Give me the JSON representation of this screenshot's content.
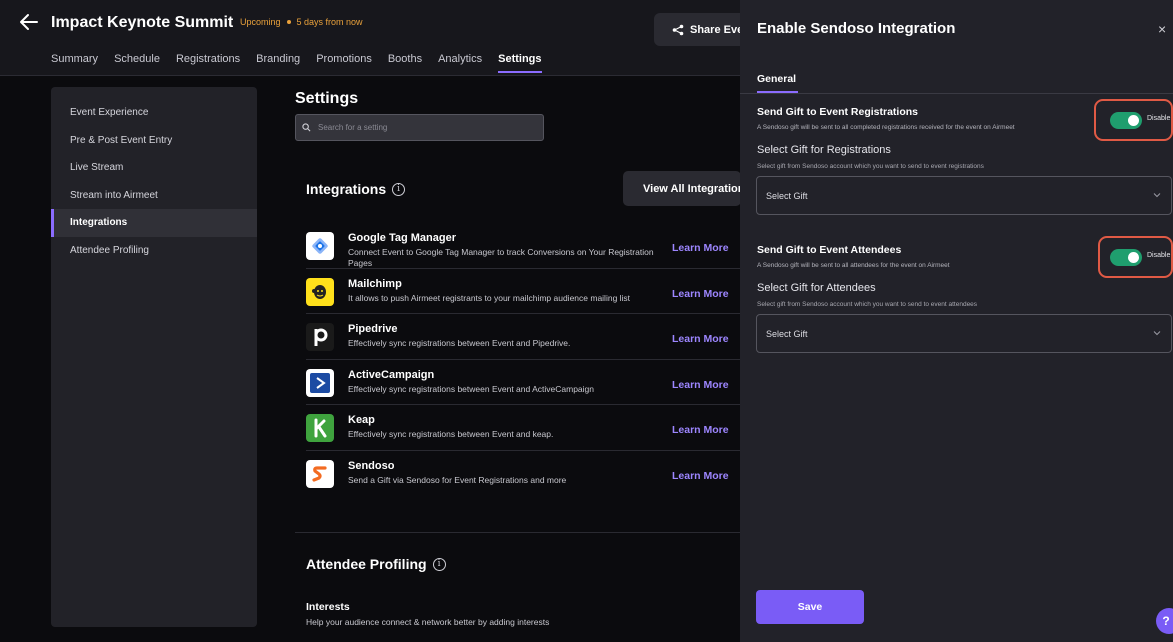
{
  "header": {
    "title": "Impact Keynote Summit",
    "status": "Upcoming",
    "countdown": "5 days from now",
    "share_label": "Share Event",
    "tabs": [
      {
        "label": "Summary"
      },
      {
        "label": "Schedule"
      },
      {
        "label": "Registrations"
      },
      {
        "label": "Branding"
      },
      {
        "label": "Promotions"
      },
      {
        "label": "Booths"
      },
      {
        "label": "Analytics"
      },
      {
        "label": "Settings",
        "active": true
      }
    ]
  },
  "sidebar": {
    "items": [
      {
        "label": "Event Experience"
      },
      {
        "label": "Pre & Post Event Entry"
      },
      {
        "label": "Live Stream"
      },
      {
        "label": "Stream into Airmeet"
      },
      {
        "label": "Integrations",
        "active": true
      },
      {
        "label": "Attendee Profiling"
      }
    ]
  },
  "settings": {
    "title": "Settings",
    "search_placeholder": "Search for a setting"
  },
  "integrations": {
    "heading": "Integrations",
    "view_all_label": "View All Integrations",
    "learn_more_label": "Learn More",
    "items": [
      {
        "name": "Google Tag Manager",
        "desc": "Connect Event to Google Tag Manager to track Conversions on Your Registration Pages",
        "icon": "google-tag-manager-logo"
      },
      {
        "name": "Mailchimp",
        "desc": "It allows to push Airmeet registrants to your mailchimp audience mailing list",
        "icon": "mailchimp-logo"
      },
      {
        "name": "Pipedrive",
        "desc": "Effectively sync registrations between Event and Pipedrive.",
        "icon": "pipedrive-logo"
      },
      {
        "name": "ActiveCampaign",
        "desc": "Effectively sync registrations between Event and ActiveCampaign",
        "icon": "activecampaign-logo"
      },
      {
        "name": "Keap",
        "desc": "Effectively sync registrations between Event and keap.",
        "icon": "keap-logo"
      },
      {
        "name": "Sendoso",
        "desc": "Send a Gift via Sendoso for Event Registrations and more",
        "icon": "sendoso-logo"
      }
    ]
  },
  "attendee_profiling": {
    "heading": "Attendee Profiling",
    "interests_title": "Interests",
    "interests_desc": "Help your audience connect & network better by adding interests"
  },
  "drawer": {
    "title": "Enable Sendoso Integration",
    "close_label": "×",
    "tab_label": "General",
    "registrations": {
      "heading": "Send Gift to Event Registrations",
      "desc": "A Sendoso gift will be sent to all completed registrations received for the event on Airmeet",
      "toggle_label": "Disable",
      "select_label": "Select Gift for Registrations",
      "select_desc": "Select gift from Sendoso account which you want to send to event registrations",
      "select_value": "Select Gift"
    },
    "attendees": {
      "heading": "Send Gift to Event Attendees",
      "desc": "A Sendoso gift will be sent to all attendees for the event on Airmeet",
      "toggle_label": "Disable",
      "select_label": "Select Gift for Attendees",
      "select_desc": "Select gift from Sendoso account which you want to send to event attendees",
      "select_value": "Select Gift"
    },
    "save_label": "Save",
    "help_label": "?"
  },
  "colors": {
    "accent": "#8b6cff",
    "toggle_on": "#1f9e6e",
    "highlight": "#e05a45",
    "status": "#e9a13b"
  }
}
